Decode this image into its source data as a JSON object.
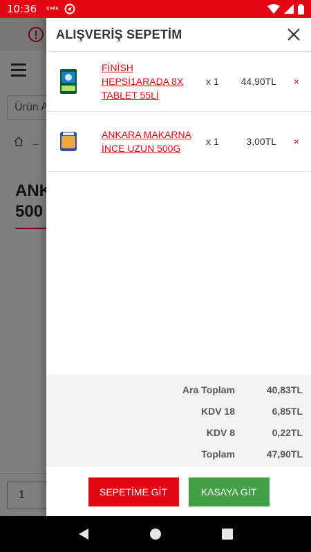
{
  "status_bar": {
    "time": "10:36",
    "carrier": "CAPA",
    "icons": [
      "app-notification-icon",
      "wifi-icon",
      "signal-icon",
      "battery-icon"
    ]
  },
  "background_page": {
    "search_placeholder": "Ürün A",
    "breadcrumb_separator": "→",
    "breadcrumb_fragment": "·",
    "title": "ANK\n500",
    "quantity": "1"
  },
  "cart": {
    "title": "ALIŞVERİŞ SEPETİM",
    "items": [
      {
        "name": "FİNİSH HEPSİ1ARADA 8X TABLET 55Lİ",
        "quantity": "x 1",
        "price": "44,90TL",
        "remove": "×",
        "thumb_icon": "dishwasher-tablet-box-icon"
      },
      {
        "name": "ANKARA MAKARNA İNCE UZUN 500G",
        "quantity": "x 1",
        "price": "3,00TL",
        "remove": "×",
        "thumb_icon": "pasta-package-icon"
      }
    ],
    "totals": [
      {
        "label": "Ara Toplam",
        "value": "40,83TL"
      },
      {
        "label": "KDV 18",
        "value": "6,85TL"
      },
      {
        "label": "KDV 8",
        "value": "0,22TL"
      },
      {
        "label": "Toplam",
        "value": "47,90TL"
      }
    ],
    "buttons": {
      "go_to_cart": "SEPETİME GİT",
      "checkout": "KASAYA GİT"
    }
  },
  "colors": {
    "brand_red": "#e30613",
    "checkout_green": "#43a047"
  }
}
